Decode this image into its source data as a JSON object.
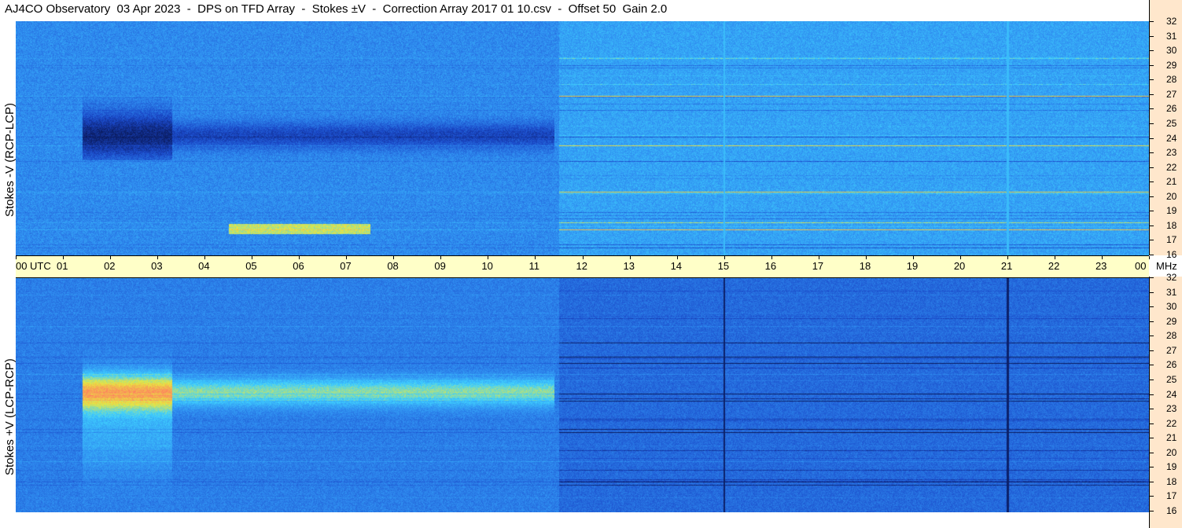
{
  "title": "AJ4CO Observatory  03 Apr 2023  -  DPS on TFD Array  -  Stokes ±V  -  Correction Array 2017 01 10.csv  -  Offset 50  Gain 2.0",
  "panels": [
    {
      "ylabel": "Stokes -V (RCP-LCP)"
    },
    {
      "ylabel": "Stokes +V (LCP-RCP)"
    }
  ],
  "chart_data": {
    "type": "heatmap",
    "x_unit": "UTC",
    "y_unit": "MHz",
    "x_ticks": [
      "00",
      "01",
      "02",
      "03",
      "04",
      "05",
      "06",
      "07",
      "08",
      "09",
      "10",
      "11",
      "12",
      "13",
      "14",
      "15",
      "16",
      "17",
      "18",
      "19",
      "20",
      "21",
      "22",
      "23",
      "00"
    ],
    "y_ticks": [
      32,
      31,
      30,
      29,
      28,
      27,
      26,
      25,
      24,
      23,
      22,
      21,
      20,
      19,
      18,
      17,
      16
    ],
    "xlim": [
      0,
      24
    ],
    "ylim": [
      16,
      32
    ],
    "colormap": [
      "#0a1a5c",
      "#1a48c8",
      "#2f8cf0",
      "#3fd0ff",
      "#e8e840",
      "#ff8060",
      "#ff40c0"
    ]
  }
}
